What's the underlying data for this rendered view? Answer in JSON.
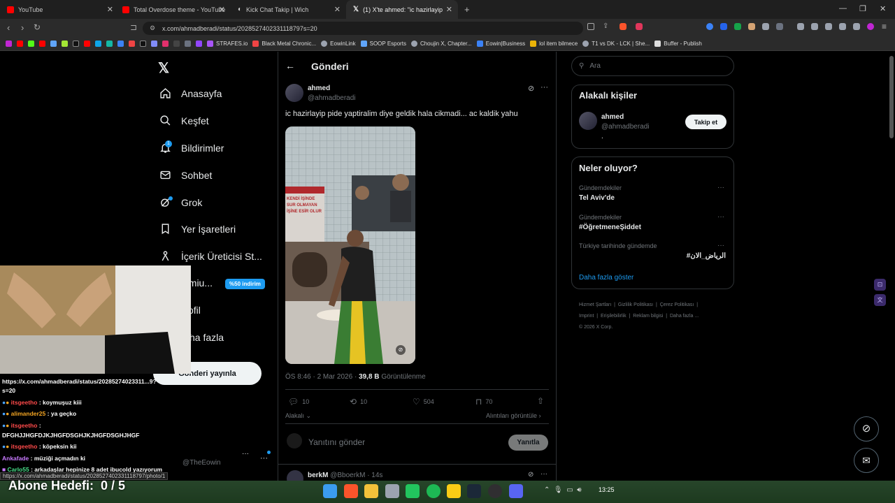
{
  "tabs": [
    {
      "title": "YouTube",
      "color": "#ff0000"
    },
    {
      "title": "Total Overdose theme - YouTube",
      "color": "#ff0000"
    },
    {
      "title": "Kick Chat Takip | Wich",
      "color": "#888888"
    },
    {
      "title": "(1) X'te ahmed: \"ic hazirlayip pide",
      "color": "#ffffff"
    }
  ],
  "url": "x.com/ahmadberadi/status/2028527402331118797s=20",
  "bookmarks": [
    "STRAFES.io",
    "Black Metal Chronic...",
    "EowinLink",
    "SOOP Esports",
    "Choujin X, Chapter...",
    "Eowin|Business",
    "lol item bilmece",
    "T1 vs DK - LCK | She...",
    "Buffer - Publish"
  ],
  "sidebar": {
    "items": [
      {
        "label": "Anasayfa"
      },
      {
        "label": "Keşfet"
      },
      {
        "label": "Bildirimler",
        "badge": "1"
      },
      {
        "label": "Sohbet"
      },
      {
        "label": "Grok"
      },
      {
        "label": "Yer İşaretleri"
      },
      {
        "label": "İçerik Üreticisi St..."
      },
      {
        "label": "emiu...",
        "badge": "%50 indirim"
      },
      {
        "label": "ofil"
      },
      {
        "label": "ha fazla"
      }
    ],
    "post_button": "Gönderi yayınla",
    "account_handle": "@TheEowin"
  },
  "header": {
    "title": "Gönderi"
  },
  "post": {
    "name": "ahmed",
    "handle": "@ahmadberadi",
    "text": "ic hazirlayip pide yaptiralim diye geldik hala cikmadi... ac kaldik yahu",
    "poster_signs": [
      "KENDİ İŞİNDE",
      "SUR OLMAYAN",
      "İŞİNE ESİR OLUR"
    ],
    "time": "ÖS 8:46 · 2 Mar 2026 ·",
    "views_count": "39,8 B",
    "views_label": "Görüntülenme",
    "replies": "10",
    "reposts": "10",
    "likes": "504",
    "bookmarks": "70",
    "relevance": "Alakalı",
    "quotes_link": "Alıntıları görüntüle",
    "reply_placeholder": "Yanıtını gönder",
    "reply_button": "Yanıtla"
  },
  "next_reply": {
    "name": "berkM",
    "handle": "@BboerkM",
    "time": "· 14s"
  },
  "search": {
    "placeholder": "Ara"
  },
  "related": {
    "title": "Alakalı kişiler",
    "name": "ahmed",
    "handle": "@ahmadberadi",
    "bio": ".",
    "follow": "Takip et"
  },
  "trends": {
    "title": "Neler oluyor?",
    "items": [
      {
        "category": "Gündemdekiler",
        "name": "Tel Aviv'de"
      },
      {
        "category": "Gündemdekiler",
        "name": "#ÖğretmeneŞiddet"
      },
      {
        "category": "Türkiye tarihinde gündemde",
        "name": "#الرياض_الان"
      }
    ],
    "more": "Daha fazla göster"
  },
  "footer": {
    "links": [
      "Hizmet Şartları",
      "Gizlilik Politikası",
      "Çerez Politikası",
      "Imprint",
      "Erişilebilirlik",
      "Reklam bilgisi",
      "Daha fazla ..."
    ],
    "copyright": "© 2026 X Corp."
  },
  "overlay": {
    "link_line1": "https://x.com/ahmadberadi/status/20285274023311...9?",
    "link_line2": "s=20",
    "chat": [
      {
        "user": "itsgeetho",
        "msg": ": koymuşuz kiii",
        "color": "#ff4a4a"
      },
      {
        "user": "alimander25",
        "msg": ": ya geçko",
        "color": "#f5a623"
      },
      {
        "user": "itsgeetho",
        "msg": ":",
        "color": "#ff4a4a"
      },
      {
        "user": "",
        "msg": "DFGHJJHGFDJKJHGFDSGHJKJHGFDSGHJHGF",
        "color": "#ffffff"
      },
      {
        "user": "itsgeetho",
        "msg": ": köpeksin kii",
        "color": "#ff4a4a"
      },
      {
        "user": "Ankafade",
        "msg": ": müziği açmadın ki",
        "color": "#c779ff"
      },
      {
        "user": "Carlo55",
        "msg": ": arkadaşlar hepinize 8 adet ibucold yazıyorum",
        "color": "#49e08a"
      }
    ],
    "status_url": "https://x.com/ahmadberadi/status/2028527402331118797/photo/1",
    "goal": "Abone Hedefi:  0 / 5"
  },
  "taskbar": {
    "time": "13:25"
  }
}
